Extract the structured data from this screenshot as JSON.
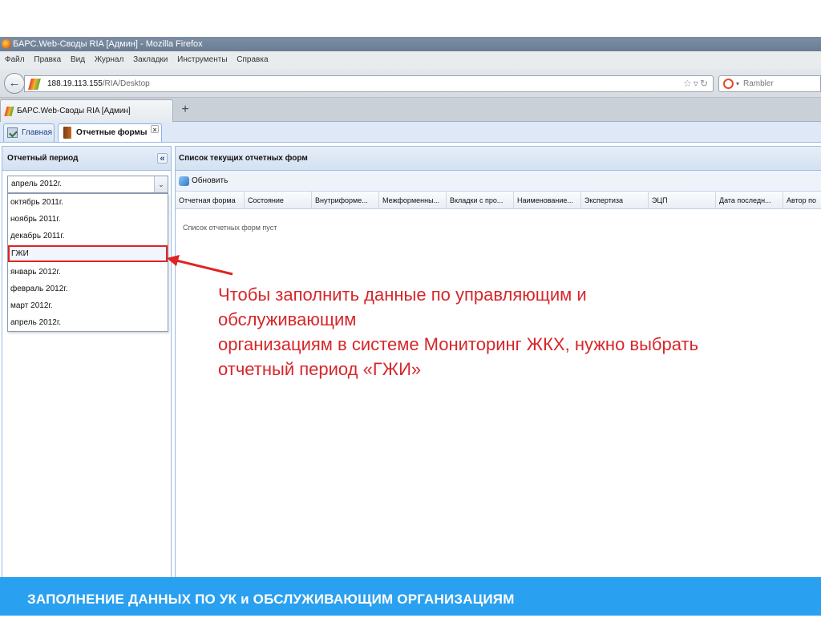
{
  "browser": {
    "window_title": "БАРС.Web-Своды RIA [Админ] - Mozilla Firefox",
    "menu": [
      "Файл",
      "Правка",
      "Вид",
      "Журнал",
      "Закладки",
      "Инструменты",
      "Справка"
    ],
    "url_host": "188.19.113.155",
    "url_path": "/RIA/Desktop",
    "search_engine": "Rambler",
    "tab_title": "БАРС.Web-Своды RIA [Админ]",
    "new_tab_label": "+"
  },
  "app": {
    "tabs": [
      {
        "label": "Главная"
      },
      {
        "label": "Отчетные формы",
        "close": "×"
      }
    ],
    "period_panel": {
      "title": "Отчетный период",
      "collapse": "«",
      "selected": "апрель 2012г.",
      "trigger": "⌄",
      "options": [
        "октябрь 2011г.",
        "ноябрь 2011г.",
        "декабрь 2011г.",
        "ГЖИ",
        "январь 2012г.",
        "февраль 2012г.",
        "март 2012г.",
        "апрель 2012г."
      ]
    },
    "forms_panel": {
      "title": "Список текущих отчетных форм",
      "refresh_label": "Обновить",
      "columns": [
        "Отчетная форма",
        "Состояние",
        "Внутриформе...",
        "Межформенны...",
        "Вкладки с про...",
        "Наименование...",
        "Экспертиза",
        "ЭЦП",
        "Дата последн...",
        "Автор по"
      ],
      "empty_text": "Список отчетных форм пуст"
    }
  },
  "annotation": {
    "lines": [
      "Чтобы заполнить данные по управляющим и",
      "обслуживающим",
      "организациям в системе Мониторинг ЖКХ, нужно выбрать",
      "отчетный период «ГЖИ»"
    ],
    "color": "#d7262a"
  },
  "footer": {
    "text": "ЗАПОЛНЕНИЕ ДАННЫХ ПО УК и ОБСЛУЖИВАЮЩИМ ОРГАНИЗАЦИЯМ",
    "color": "#2aa0f0"
  }
}
